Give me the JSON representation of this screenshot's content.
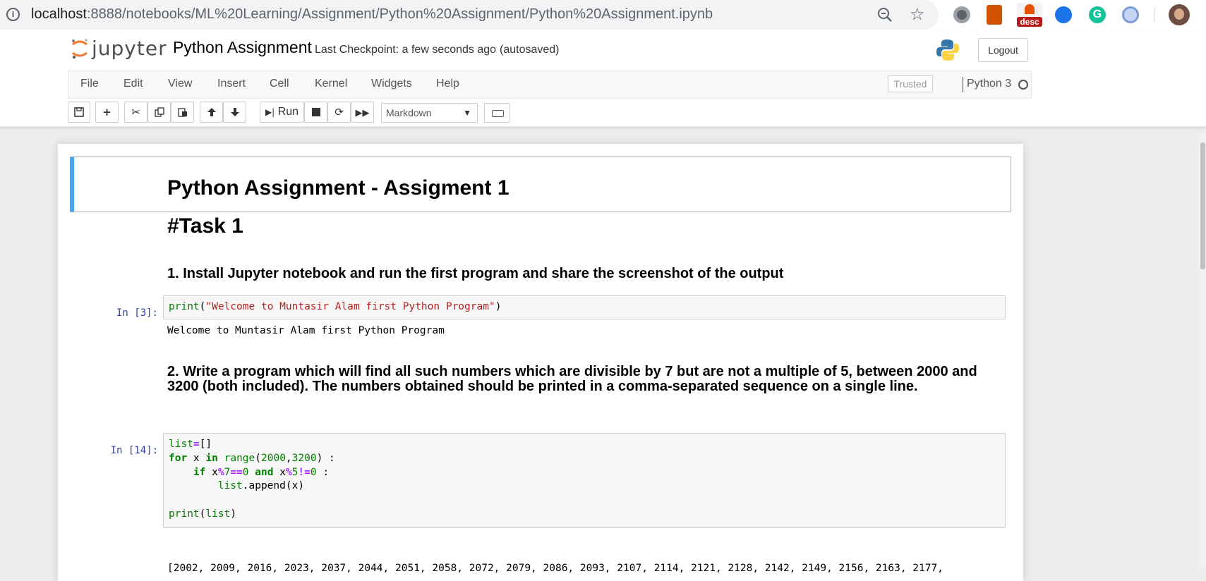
{
  "browser": {
    "url_host": "localhost",
    "url_path": ":8888/notebooks/ML%20Learning/Assignment/Python%20Assignment/Python%20Assignment.ipynb",
    "extension_badge": "desc",
    "grammarly_letter": "G"
  },
  "header": {
    "logo_text": "jupyter",
    "notebook_name": "Python Assignment",
    "checkpoint": "Last Checkpoint: a few seconds ago",
    "autosave_status": "(autosaved)",
    "logout_label": "Logout"
  },
  "menubar": {
    "items": [
      "File",
      "Edit",
      "View",
      "Insert",
      "Cell",
      "Kernel",
      "Widgets",
      "Help"
    ],
    "trusted_label": "Trusted",
    "kernel_name": "Python 3"
  },
  "toolbar": {
    "run_label": "Run",
    "cell_type": "Markdown"
  },
  "notebook": {
    "title": "Python Assignment - Assigment 1",
    "task_heading": "#Task 1",
    "q1": "1. Install Jupyter notebook and run the first program and share the screenshot of the output",
    "cell1": {
      "prompt": "In [3]:",
      "code_fn": "print",
      "code_str": "\"Welcome to Muntasir Alam first Python Program\"",
      "output": "Welcome to Muntasir Alam first Python Program"
    },
    "q2": "2. Write a program which will find all such numbers which are divisible by 7 but are not a multiple of 5, between 2000 and 3200 (both included). The numbers obtained should be printed in a comma-separated sequence on a single line.",
    "cell2": {
      "prompt": "In [14]:",
      "output": "[2002, 2009, 2016, 2023, 2037, 2044, 2051, 2058, 2072, 2079, 2086, 2093, 2107, 2114, 2121, 2128, 2142, 2149, 2156, 2163, 2177,"
    }
  }
}
